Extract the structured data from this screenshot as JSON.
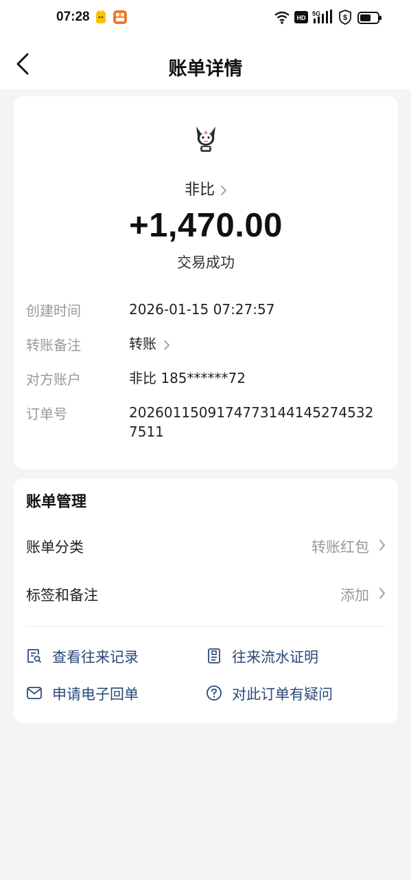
{
  "status_bar": {
    "time": "07:28",
    "icons": [
      "app-icon-1",
      "app-icon-2",
      "wifi-icon",
      "hd-icon",
      "5g-signal-icon",
      "security-icon",
      "battery-icon"
    ],
    "network": "5G",
    "hd": "HD"
  },
  "nav": {
    "title": "账单详情",
    "back_icon": "chevron-left-icon"
  },
  "transaction": {
    "avatar_icon": "kuromi-avatar",
    "payer": "非比",
    "amount": "+1,470.00",
    "status": "交易成功"
  },
  "details": [
    {
      "label": "创建时间",
      "value": "2026-01-15 07:27:57"
    },
    {
      "label": "转账备注",
      "value": "转账"
    },
    {
      "label": "对方账户",
      "value": "非比 185******72"
    },
    {
      "label": "订单号",
      "value": "2026011509174773144145274532 7511"
    }
  ],
  "manage": {
    "title": "账单管理",
    "rows": [
      {
        "label": "账单分类",
        "value": "转账红包"
      },
      {
        "label": "标签和备注",
        "value": "添加"
      }
    ],
    "actions": [
      {
        "label": "查看往来记录",
        "icon": "record-search-icon"
      },
      {
        "label": "往来流水证明",
        "icon": "document-icon"
      },
      {
        "label": "申请电子回单",
        "icon": "mail-icon"
      },
      {
        "label": "对此订单有疑问",
        "icon": "help-icon"
      }
    ]
  },
  "colors": {
    "background": "#f4f4f4",
    "card": "#ffffff",
    "action_text": "#2a4a78",
    "muted": "#999999"
  }
}
